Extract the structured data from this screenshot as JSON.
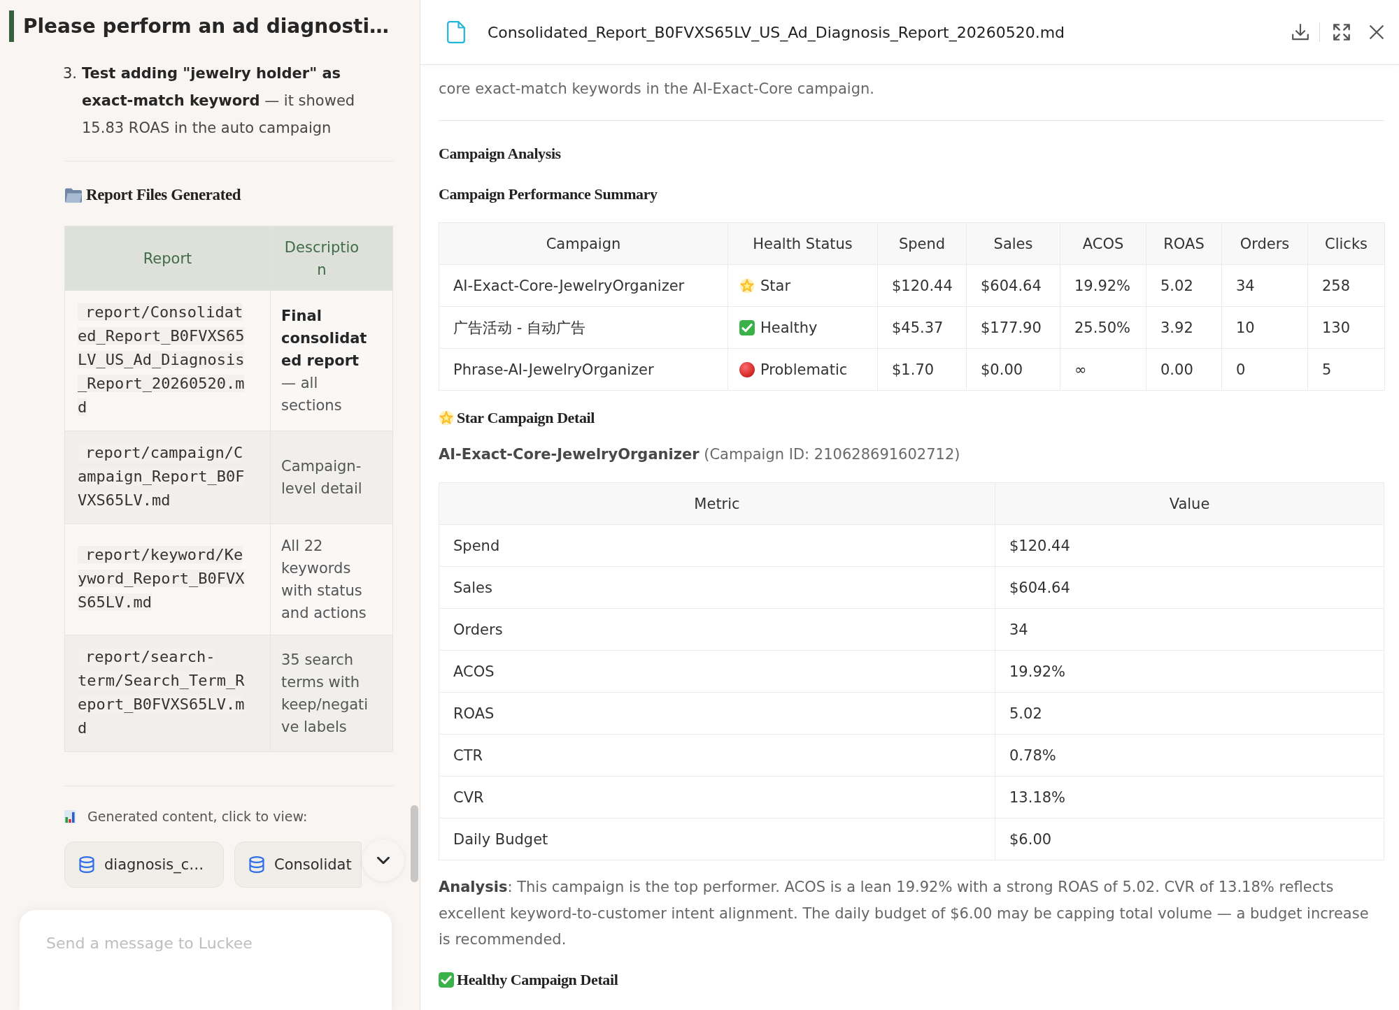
{
  "chat": {
    "title": "Please perform an ad diagnosti…",
    "list_item": {
      "number": "3.",
      "text": "**Test adding \"jewelry holder\" as exact-match keyword** — it showed 15.83 ROAS in the auto campaign"
    },
    "section_heading": "Report Files Generated",
    "files_table": {
      "columns": [
        "Report",
        "Description"
      ],
      "rows": [
        {
          "report": "report/Consolidated_Report_B0FVXS65LV_US_Ad_Diagnosis_Report_20260520.md",
          "description": "**Final consolidated report** — all sections"
        },
        {
          "report": "report/campaign/Campaign_Report_B0FVXS65LV.md",
          "description": "Campaign-level detail"
        },
        {
          "report": "report/keyword/Keyword_Report_B0FVXS65LV.md",
          "description": "All 22 keywords with status and actions"
        },
        {
          "report": "report/search-term/Search_Term_Report_B0FVXS65LV.md",
          "description": "35 search terms with keep/negative labels"
        }
      ]
    },
    "generated_label": "Generated content, click to view:",
    "attachments": [
      {
        "name": "diagnosis_c…"
      },
      {
        "name": "Consolidat"
      }
    ],
    "composer": {
      "placeholder": "Send a message to Luckee"
    }
  },
  "document": {
    "title": "Consolidated_Report_B0FVXS65LV_US_Ad_Diagnosis_Report_20260520.md",
    "intro": "core exact-match keywords in the AI-Exact-Core campaign.",
    "section_title": "Campaign Analysis",
    "summary": {
      "heading": "Campaign Performance Summary",
      "columns": [
        "Campaign",
        "Health Status",
        "Spend",
        "Sales",
        "ACOS",
        "ROAS",
        "Orders",
        "Clicks"
      ],
      "rows": [
        {
          "campaign": "AI-Exact-Core-JewelryOrganizer",
          "status": {
            "kind": "star",
            "label": "Star"
          },
          "values": [
            "$120.44",
            "$604.64",
            "19.92%",
            "5.02",
            "34",
            "258"
          ]
        },
        {
          "campaign": "广告活动 - 自动广告",
          "status": {
            "kind": "healthy",
            "label": "Healthy"
          },
          "values": [
            "$45.37",
            "$177.90",
            "25.50%",
            "3.92",
            "10",
            "130"
          ]
        },
        {
          "campaign": "Phrase-AI-JewelryOrganizer",
          "status": {
            "kind": "problematic",
            "label": "Problematic"
          },
          "values": [
            "$1.70",
            "$0.00",
            "∞",
            "0.00",
            "0",
            "5"
          ]
        }
      ]
    },
    "star_detail": {
      "heading": {
        "kind": "star",
        "text": "Star Campaign Detail"
      },
      "subtitle": "**AI-Exact-Core-JewelryOrganizer** (Campaign ID: 210628691602712)",
      "columns": [
        "Metric",
        "Value"
      ],
      "rows": [
        [
          "Spend",
          "$120.44"
        ],
        [
          "Sales",
          "$604.64"
        ],
        [
          "Orders",
          "34"
        ],
        [
          "ACOS",
          "19.92%"
        ],
        [
          "ROAS",
          "5.02"
        ],
        [
          "CTR",
          "0.78%"
        ],
        [
          "CVR",
          "13.18%"
        ],
        [
          "Daily Budget",
          "$6.00"
        ]
      ],
      "analysis": "**Analysis**: This campaign is the top performer. ACOS is a lean 19.92% with a strong ROAS of 5.02. CVR of 13.18% reflects excellent keyword-to-customer intent alignment. The daily budget of $6.00 may be capping total volume — a budget increase is recommended."
    },
    "next_heading": {
      "kind": "healthy",
      "text": "Healthy Campaign Detail"
    }
  }
}
